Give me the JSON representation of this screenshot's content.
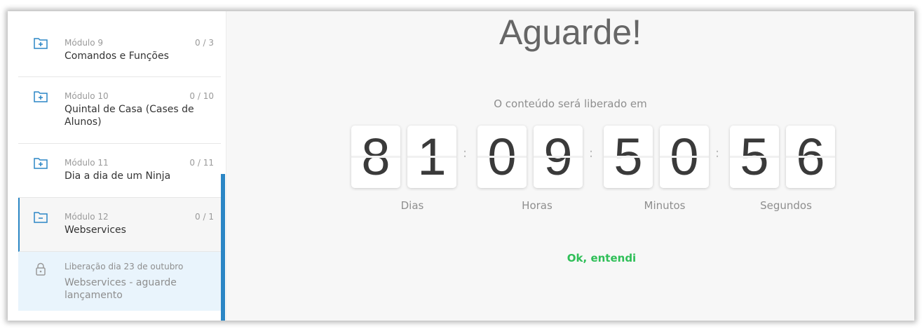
{
  "sidebar": {
    "modules": [
      {
        "number": "Módulo 9",
        "count": "0 / 3",
        "title": "Comandos e Funções",
        "icon": "folder-plus-icon"
      },
      {
        "number": "Módulo 10",
        "count": "0 / 10",
        "title": "Quintal de Casa (Cases de Alunos)",
        "icon": "folder-plus-icon"
      },
      {
        "number": "Módulo 11",
        "count": "0 / 11",
        "title": "Dia a dia de um Ninja",
        "icon": "folder-plus-icon"
      },
      {
        "number": "Módulo 12",
        "count": "0 / 1",
        "title": "Webservices",
        "icon": "folder-minus-icon"
      }
    ],
    "lesson": {
      "date": "Liberação dia 23 de outubro",
      "title": "Webservices - aguarde lançamento",
      "icon": "lock-icon"
    }
  },
  "main": {
    "heading": "Aguarde!",
    "subtitle": "O conteúdo será liberado em",
    "countdown": {
      "days": [
        "8",
        "1"
      ],
      "hours": [
        "0",
        "9"
      ],
      "minutes": [
        "5",
        "0"
      ],
      "seconds": [
        "5",
        "6"
      ],
      "separator": ":",
      "labels": {
        "days": "Dias",
        "hours": "Horas",
        "minutes": "Minutos",
        "seconds": "Segundos"
      }
    },
    "ok_button": "Ok, entendi"
  },
  "colors": {
    "accent": "#2b86c5",
    "ok": "#2fbf58",
    "lesson_bg": "#e9f4fc"
  }
}
